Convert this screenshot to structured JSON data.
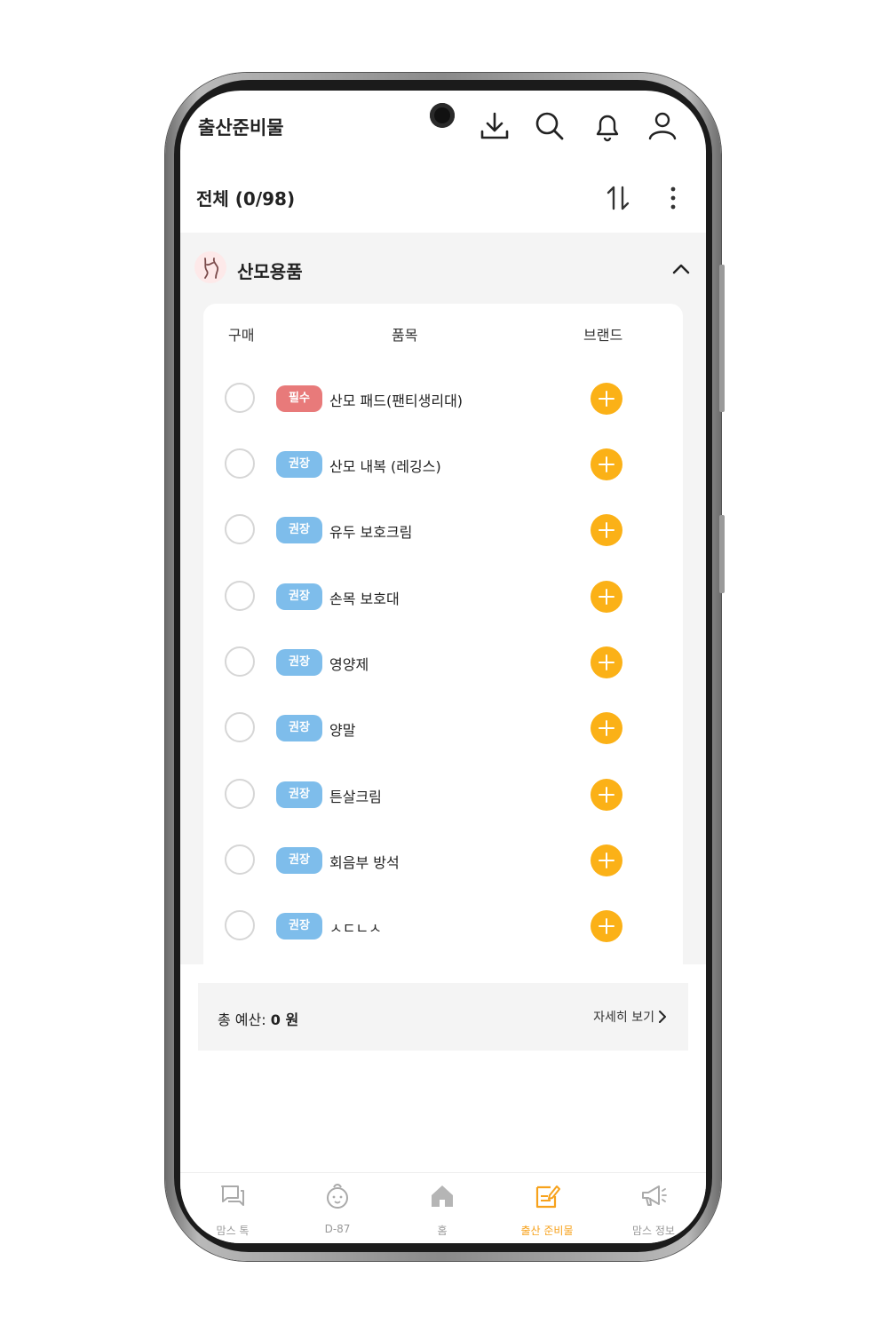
{
  "app": {
    "title": "출산준비물"
  },
  "header_icons": [
    "download-icon",
    "search-icon",
    "bell-icon",
    "user-icon"
  ],
  "list": {
    "count_label": "전체 (0/98)"
  },
  "category": {
    "title": "산모용품",
    "expanded": true
  },
  "columns": {
    "purchase": "구매",
    "item": "품목",
    "brand": "브랜드"
  },
  "colors": {
    "essential": "#e87a7a",
    "recommended": "#7ebdeb",
    "add": "#fbb117",
    "active_nav": "#f7a21c"
  },
  "items": [
    {
      "tag": "필수",
      "type": "essential",
      "name": "산모 패드(팬티생리대)"
    },
    {
      "tag": "권장",
      "type": "recommended",
      "name": "산모 내복 (레깅스)"
    },
    {
      "tag": "권장",
      "type": "recommended",
      "name": "유두 보호크림"
    },
    {
      "tag": "권장",
      "type": "recommended",
      "name": "손목 보호대"
    },
    {
      "tag": "권장",
      "type": "recommended",
      "name": "영양제"
    },
    {
      "tag": "권장",
      "type": "recommended",
      "name": "양말"
    },
    {
      "tag": "권장",
      "type": "recommended",
      "name": "튼살크림"
    },
    {
      "tag": "권장",
      "type": "recommended",
      "name": "회음부 방석"
    },
    {
      "tag": "권장",
      "type": "recommended",
      "name": "ㅅㄷㄴㅅ"
    }
  ],
  "budget": {
    "label": "총 예산:",
    "value": "0 원",
    "detail": "자세히 보기"
  },
  "nav": [
    {
      "label": "맘스 톡",
      "icon": "chat-icon",
      "active": false
    },
    {
      "label": "D-87",
      "icon": "baby-icon",
      "active": false
    },
    {
      "label": "홈",
      "icon": "home-icon",
      "active": false
    },
    {
      "label": "출산 준비물",
      "icon": "checklist-icon",
      "active": true
    },
    {
      "label": "맘스 정보",
      "icon": "megaphone-icon",
      "active": false
    }
  ]
}
